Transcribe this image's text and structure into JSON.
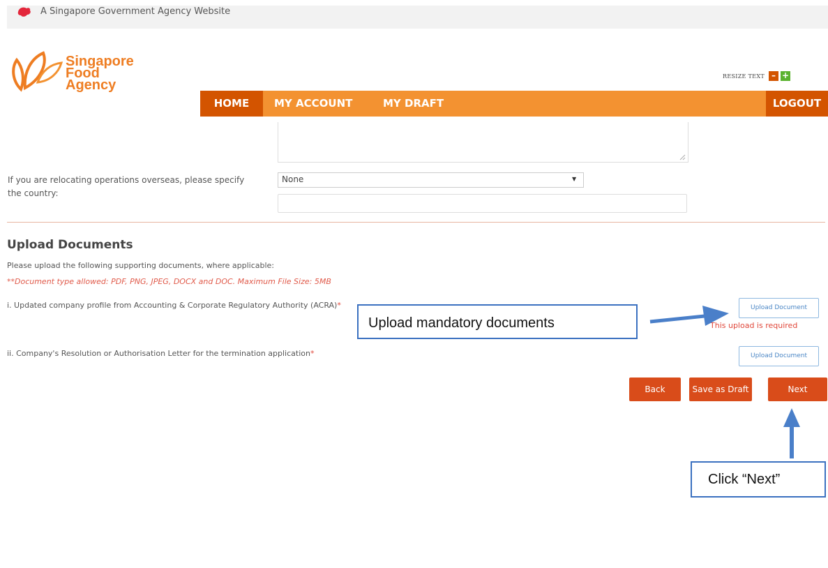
{
  "gov_banner": {
    "text": "A Singapore Government Agency Website",
    "icon": "lion-head-icon"
  },
  "logo": {
    "line1": "Singapore",
    "line2": "Food",
    "line3": "Agency",
    "icon": "sfa-leaf-logo-icon"
  },
  "resize": {
    "label": "RESIZE TEXT",
    "minus": "–",
    "plus": "+"
  },
  "nav": {
    "home": "HOME",
    "my_account": "MY ACCOUNT",
    "my_draft": "MY DRAFT",
    "logout": "LOGOUT"
  },
  "form": {
    "relocate_label": "If you are relocating operations overseas, please specify the country:",
    "country_select": "None",
    "country_input": ""
  },
  "upload": {
    "title": "Upload Documents",
    "description": "Please upload the following supporting documents, where applicable:",
    "note": "**Document type allowed: PDF, PNG, JPEG, DOCX and DOC. Maximum File Size: 5MB",
    "doc1_label": "i. Updated company profile from Accounting & Corporate Regulatory Authority (ACRA)",
    "doc2_label": "ii. Company's Resolution or Authorisation Letter for the termination application",
    "doc_star": "*",
    "upload_button": "Upload Document",
    "doc1_error": "This upload is required"
  },
  "actions": {
    "back": "Back",
    "save_draft": "Save as Draft",
    "next": "Next"
  },
  "annotations": {
    "callout1": "Upload mandatory documents",
    "callout2": "Click “Next”"
  },
  "colors": {
    "brand_orange": "#f39231",
    "brand_dark_orange": "#d35400",
    "button_red": "#d94c1a",
    "error_red": "#e0473a",
    "annotation_blue": "#3a70c0"
  }
}
